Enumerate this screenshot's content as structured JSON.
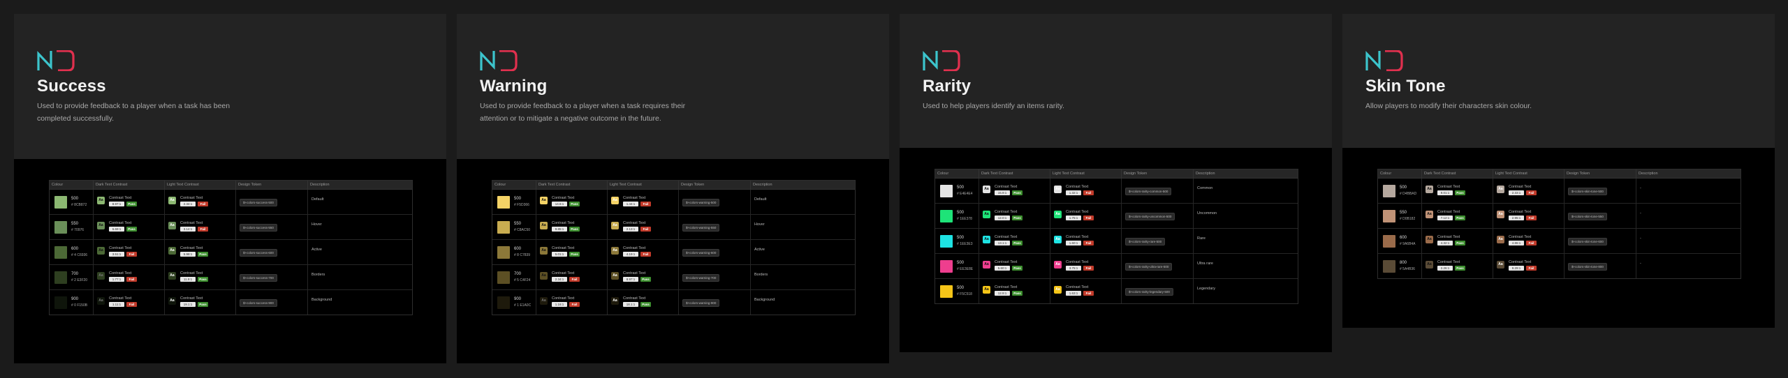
{
  "columns": [
    "Colour",
    "Dark Text Contrast",
    "Light Text Contrast",
    "Design Token",
    "Description"
  ],
  "contrast_label": "Contrast Text",
  "chip_text": "Aa",
  "brand_colors": {
    "teal": "#3cc4cc",
    "red": "#e0304e"
  },
  "cards": [
    {
      "title": "Success",
      "description": "Used to provide feedback to a player when a task has been completed successfully.",
      "rows": [
        {
          "name": "500",
          "hex": "# 8CB872",
          "swatch": "#8cb872",
          "dark_ratio": "8.97:1",
          "dark_status": "Pass",
          "light_ratio": "2.34:1",
          "light_status": "Fail",
          "token": "$+colors-success-500",
          "description": "Default"
        },
        {
          "name": "550",
          "hex": "# 70976",
          "swatch": "#6a8f59",
          "dark_ratio": "6.69:1",
          "dark_status": "Pass",
          "light_ratio": "3.14:1",
          "light_status": "Fail",
          "token": "$+colors-success-550",
          "description": "Hover"
        },
        {
          "name": "600",
          "hex": "# 4 C6936",
          "swatch": "#4c6936",
          "dark_ratio": "3.51:1",
          "dark_status": "Fail",
          "light_ratio": "5.98:1",
          "light_status": "Pass",
          "token": "$+colors-success-600",
          "description": "Active"
        },
        {
          "name": "700",
          "hex": "# 2 E3F20",
          "swatch": "#2e3f20",
          "dark_ratio": "1.77:1",
          "dark_status": "Fail",
          "light_ratio": "11.9:1",
          "light_status": "Pass",
          "token": "$+colors-success-700",
          "description": "Borders"
        },
        {
          "name": "900",
          "hex": "# 0 F150B",
          "swatch": "#0f150b",
          "dark_ratio": "1.11:1",
          "dark_status": "Fail",
          "light_ratio": "19.1:1",
          "light_status": "Pass",
          "token": "$+colors-success-900",
          "description": "Background"
        }
      ]
    },
    {
      "title": "Warning",
      "description": "Used to provide feedback to a player when a task requires their attention or to mitigate a negative outcome in the future.",
      "rows": [
        {
          "name": "500",
          "hex": "# F5D366",
          "swatch": "#f5d366",
          "dark_ratio": "14.6:1",
          "dark_status": "Pass",
          "light_ratio": "1.44:1",
          "light_status": "Fail",
          "token": "$+colors-warning-500",
          "description": "Default"
        },
        {
          "name": "550",
          "hex": "# C8AC50",
          "swatch": "#c8ac50",
          "dark_ratio": "9.85:1",
          "dark_status": "Pass",
          "light_ratio": "2.13:1",
          "light_status": "Fail",
          "token": "$+colors-warning-550",
          "description": "Hover"
        },
        {
          "name": "600",
          "hex": "# 8 C7839",
          "swatch": "#8c7839",
          "dark_ratio": "5.01:1",
          "dark_status": "Pass",
          "light_ratio": "4.19:1",
          "light_status": "Fail",
          "token": "$+colors-warning-600",
          "description": "Active"
        },
        {
          "name": "700",
          "hex": "# 5 C4F24",
          "swatch": "#5c4f24",
          "dark_ratio": "2.34:1",
          "dark_status": "Fail",
          "light_ratio": "8.97:1",
          "light_status": "Pass",
          "token": "$+colors-warning-700",
          "description": "Borders"
        },
        {
          "name": "900",
          "hex": "# 1 E1A0C",
          "swatch": "#1e1a0c",
          "dark_ratio": "1.16:1",
          "dark_status": "Fail",
          "light_ratio": "18.1:1",
          "light_status": "Pass",
          "token": "$+colors-warning-900",
          "description": "Background"
        }
      ]
    },
    {
      "title": "Rarity",
      "description": "Used to help players identify an items rarity.",
      "rows": [
        {
          "name": "500",
          "hex": "# E4E4E4",
          "swatch": "#e4e4e4",
          "dark_ratio": "15.9:1",
          "dark_status": "Pass",
          "light_ratio": "1.32:1",
          "light_status": "Fail",
          "token": "$+colors-rarity-common-500",
          "description": "Common"
        },
        {
          "name": "500",
          "hex": "# 1EE378",
          "swatch": "#1ee378",
          "dark_ratio": "12.0:1",
          "dark_status": "Pass",
          "light_ratio": "1.75:1",
          "light_status": "Fail",
          "token": "$+colors-rarity-uncommon-500",
          "description": "Uncommon"
        },
        {
          "name": "500",
          "hex": "# 1EE3E3",
          "swatch": "#1ee3e3",
          "dark_ratio": "13.1:1",
          "dark_status": "Pass",
          "light_ratio": "1.60:1",
          "light_status": "Fail",
          "token": "$+colors-rarity-rare-500",
          "description": "Rare"
        },
        {
          "name": "500",
          "hex": "# EE3E8E",
          "swatch": "#ee3e8e",
          "dark_ratio": "5.60:1",
          "dark_status": "Pass",
          "light_ratio": "3.75:1",
          "light_status": "Fail",
          "token": "$+colors-rarity-ultra-rare-500",
          "description": "Ultra rare"
        },
        {
          "name": "500",
          "hex": "# F5C518",
          "swatch": "#f5c518",
          "dark_ratio": "12.9:1",
          "dark_status": "Pass",
          "light_ratio": "1.63:1",
          "light_status": "Fail",
          "token": "$+colors-rarity-legendary-500",
          "description": "Legendary"
        }
      ]
    },
    {
      "title": "Skin Tone",
      "description": "Allow players to modify their characters skin colour.",
      "rows": [
        {
          "name": "500",
          "hex": "# D4BBAD",
          "swatch": "#b5a89e",
          "dark_ratio": "9.01:1",
          "dark_status": "Pass",
          "light_ratio": "2.33:1",
          "light_status": "Fail",
          "token": "$+colors-skin-tone-500",
          "description": "-"
        },
        {
          "name": "550",
          "hex": "# D0B182",
          "swatch": "#c09276",
          "dark_ratio": "7.12:1",
          "dark_status": "Pass",
          "light_ratio": "2.95:1",
          "light_status": "Fail",
          "token": "$+colors-skin-tone-550",
          "description": "-"
        },
        {
          "name": "600",
          "hex": "# 9A6B4A",
          "swatch": "#9a6b4a",
          "dark_ratio": "4.32:1",
          "dark_status": "Pass",
          "light_ratio": "4.86:1",
          "light_status": "Fail",
          "token": "$+colors-skin-tone-600",
          "description": "-"
        },
        {
          "name": "800",
          "hex": "# 5A4B36",
          "swatch": "#5a4b36",
          "dark_ratio": "2.26:1",
          "dark_status": "Pass",
          "light_ratio": "9.29:1",
          "light_status": "Fail",
          "token": "$+colors-skin-tone-800",
          "description": "-"
        }
      ]
    }
  ]
}
